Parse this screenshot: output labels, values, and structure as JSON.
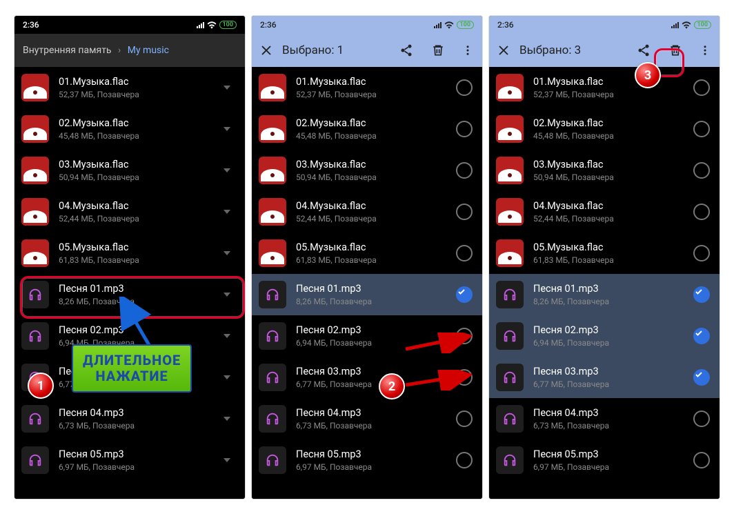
{
  "status": {
    "time": "2:36",
    "battery": "100"
  },
  "screen1": {
    "breadcrumb_root": "Внутренняя память",
    "breadcrumb_current": "My music"
  },
  "screen2": {
    "title": "Выбрано: 1"
  },
  "screen3": {
    "title": "Выбрано: 3"
  },
  "files": [
    {
      "name": "01.Музыка.flac",
      "sub": "52,37 МБ, Позавчера",
      "type": "img"
    },
    {
      "name": "02.Музыка.flac",
      "sub": "45,48 МБ, Позавчера",
      "type": "img"
    },
    {
      "name": "03.Музыка.flac",
      "sub": "50,94 МБ, Позавчера",
      "type": "img"
    },
    {
      "name": "04.Музыка.flac",
      "sub": "52,44 МБ, Позавчера",
      "type": "img"
    },
    {
      "name": "05.Музыка.flac",
      "sub": "61,83 МБ, Позавчера",
      "type": "img"
    },
    {
      "name": "Песня 01.mp3",
      "sub": "8,26 МБ, Позавчера",
      "type": "audio"
    },
    {
      "name": "Песня 02.mp3",
      "sub": "6,94 МБ, Позавчера",
      "type": "audio"
    },
    {
      "name": "Песня 03.mp3",
      "sub": "6,77 МБ, Позавчера",
      "type": "audio"
    },
    {
      "name": "Песня 04.mp3",
      "sub": "6,73 МБ, Позавчера",
      "type": "audio"
    },
    {
      "name": "Песня 05.mp3",
      "sub": "6,97 МБ, Позавчера",
      "type": "audio"
    }
  ],
  "annotations": {
    "callout": "ДЛИТЕЛЬНОЕ\nНАЖАТИЕ",
    "badges": [
      "1",
      "2",
      "3"
    ]
  }
}
